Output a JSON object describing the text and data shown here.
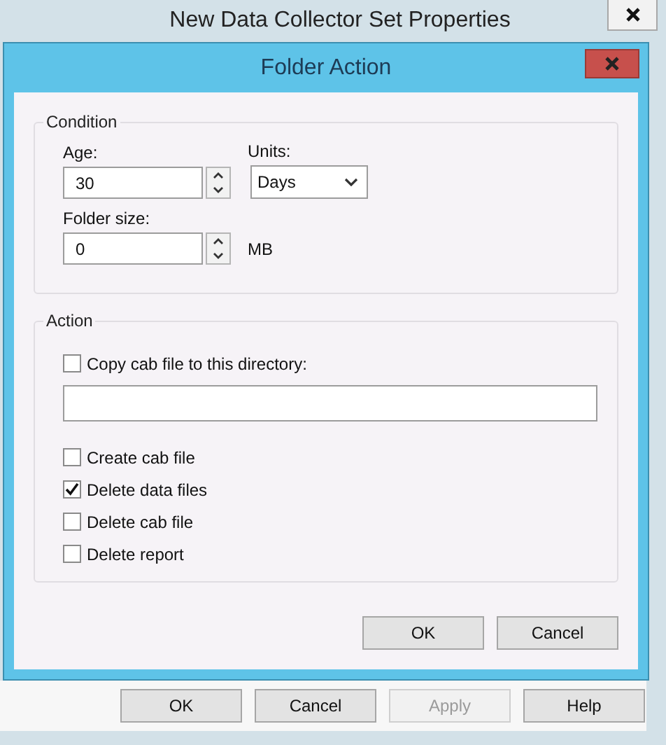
{
  "window": {
    "title": "New Data Collector Set Properties"
  },
  "dialog": {
    "title": "Folder Action",
    "condition": {
      "label": "Condition",
      "age": {
        "label": "Age:",
        "value": "30"
      },
      "units": {
        "label": "Units:",
        "value": "Days"
      },
      "folder_size": {
        "label": "Folder size:",
        "value": "0",
        "unit": "MB"
      }
    },
    "action": {
      "label": "Action",
      "copy": {
        "label": "Copy cab file to this directory:",
        "checked": false
      },
      "options": [
        {
          "label": "Create cab file",
          "checked": false
        },
        {
          "label": "Delete data files",
          "checked": true
        },
        {
          "label": "Delete cab file",
          "checked": false
        },
        {
          "label": "Delete report",
          "checked": false
        }
      ]
    },
    "buttons": [
      {
        "label": "OK"
      },
      {
        "label": "Cancel"
      }
    ]
  },
  "buttons": [
    {
      "label": "OK",
      "disabled": false
    },
    {
      "label": "Cancel",
      "disabled": false
    },
    {
      "label": "Apply",
      "disabled": true
    },
    {
      "label": "Help",
      "disabled": false
    }
  ]
}
